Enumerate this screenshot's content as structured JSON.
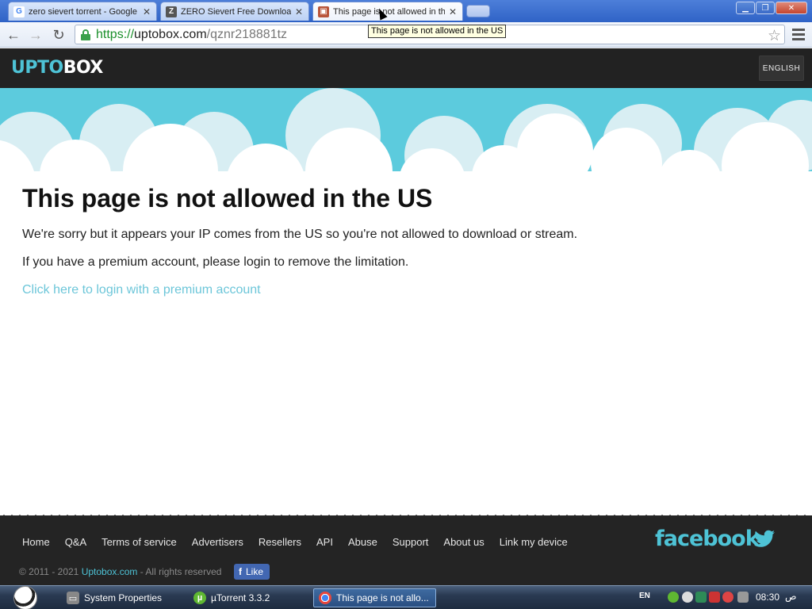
{
  "browser": {
    "tabs": [
      {
        "title": "zero sievert torrent - Google",
        "icon": "google-icon"
      },
      {
        "title": "ZERO Sievert Free Download",
        "icon": "site-icon"
      },
      {
        "title": "This page is not allowed in th",
        "icon": "uptobox-icon"
      }
    ],
    "url": {
      "scheme": "https://",
      "host": "uptobox.com",
      "path": "/qznr218881tz"
    },
    "tooltip": "This page is not allowed in the US"
  },
  "site": {
    "logo_upto": "UPTO",
    "logo_box": "BOX",
    "language_button": "ENGLISH",
    "heading": "This page is not allowed in the US",
    "message1": "We're sorry but it appears your IP comes from the US so you're not allowed to download or stream.",
    "message2": "If you have a premium account, please login to remove the limitation.",
    "login_link": "Click here to login with a premium account",
    "footer": {
      "links": [
        "Home",
        "Q&A",
        "Terms of service",
        "Advertisers",
        "Resellers",
        "API",
        "Abuse",
        "Support",
        "About us",
        "Link my device"
      ],
      "facebook": "facebook",
      "copyright": "© 2011 - 2021",
      "copyright_brand": "Uptobox.com",
      "copyright_suffix": "- All rights reserved",
      "like": "Like"
    }
  },
  "taskbar": {
    "tasks": [
      {
        "label": "System Properties",
        "icon": "system-properties-icon"
      },
      {
        "label": "µTorrent 3.3.2",
        "icon": "utorrent-icon"
      },
      {
        "label": "This page is not allo...",
        "icon": "chrome-icon"
      }
    ],
    "language": "EN",
    "clock": "08:30",
    "ampm": "ص"
  },
  "colors": {
    "accent": "#4ec3d6",
    "header_bg": "#222222",
    "footer_bg": "#242424",
    "link": "#6cc6d9"
  }
}
